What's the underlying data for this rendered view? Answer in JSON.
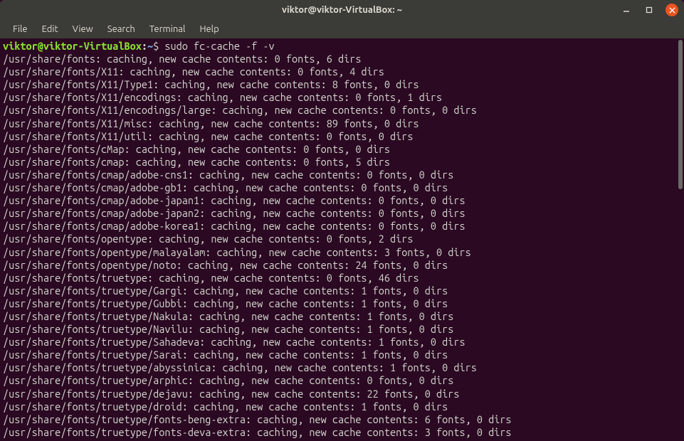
{
  "titlebar": {
    "title": "viktor@viktor-VirtualBox: ~"
  },
  "menubar": {
    "items": [
      {
        "label": "File"
      },
      {
        "label": "Edit"
      },
      {
        "label": "View"
      },
      {
        "label": "Search"
      },
      {
        "label": "Terminal"
      },
      {
        "label": "Help"
      }
    ]
  },
  "prompt": {
    "user": "viktor@viktor-VirtualBox",
    "sep": ":",
    "path": "~",
    "dollar": "$"
  },
  "command": "sudo fc-cache -f -v",
  "output": [
    "/usr/share/fonts: caching, new cache contents: 0 fonts, 6 dirs",
    "/usr/share/fonts/X11: caching, new cache contents: 0 fonts, 4 dirs",
    "/usr/share/fonts/X11/Type1: caching, new cache contents: 8 fonts, 0 dirs",
    "/usr/share/fonts/X11/encodings: caching, new cache contents: 0 fonts, 1 dirs",
    "/usr/share/fonts/X11/encodings/large: caching, new cache contents: 0 fonts, 0 dirs",
    "/usr/share/fonts/X11/misc: caching, new cache contents: 89 fonts, 0 dirs",
    "/usr/share/fonts/X11/util: caching, new cache contents: 0 fonts, 0 dirs",
    "/usr/share/fonts/cMap: caching, new cache contents: 0 fonts, 0 dirs",
    "/usr/share/fonts/cmap: caching, new cache contents: 0 fonts, 5 dirs",
    "/usr/share/fonts/cmap/adobe-cns1: caching, new cache contents: 0 fonts, 0 dirs",
    "/usr/share/fonts/cmap/adobe-gb1: caching, new cache contents: 0 fonts, 0 dirs",
    "/usr/share/fonts/cmap/adobe-japan1: caching, new cache contents: 0 fonts, 0 dirs",
    "/usr/share/fonts/cmap/adobe-japan2: caching, new cache contents: 0 fonts, 0 dirs",
    "/usr/share/fonts/cmap/adobe-korea1: caching, new cache contents: 0 fonts, 0 dirs",
    "/usr/share/fonts/opentype: caching, new cache contents: 0 fonts, 2 dirs",
    "/usr/share/fonts/opentype/malayalam: caching, new cache contents: 3 fonts, 0 dirs",
    "/usr/share/fonts/opentype/noto: caching, new cache contents: 24 fonts, 0 dirs",
    "/usr/share/fonts/truetype: caching, new cache contents: 0 fonts, 46 dirs",
    "/usr/share/fonts/truetype/Gargi: caching, new cache contents: 1 fonts, 0 dirs",
    "/usr/share/fonts/truetype/Gubbi: caching, new cache contents: 1 fonts, 0 dirs",
    "/usr/share/fonts/truetype/Nakula: caching, new cache contents: 1 fonts, 0 dirs",
    "/usr/share/fonts/truetype/Navilu: caching, new cache contents: 1 fonts, 0 dirs",
    "/usr/share/fonts/truetype/Sahadeva: caching, new cache contents: 1 fonts, 0 dirs",
    "/usr/share/fonts/truetype/Sarai: caching, new cache contents: 1 fonts, 0 dirs",
    "/usr/share/fonts/truetype/abyssinica: caching, new cache contents: 1 fonts, 0 dirs",
    "/usr/share/fonts/truetype/arphic: caching, new cache contents: 0 fonts, 0 dirs",
    "/usr/share/fonts/truetype/dejavu: caching, new cache contents: 22 fonts, 0 dirs",
    "/usr/share/fonts/truetype/droid: caching, new cache contents: 1 fonts, 0 dirs",
    "/usr/share/fonts/truetype/fonts-beng-extra: caching, new cache contents: 6 fonts, 0 dirs",
    "/usr/share/fonts/truetype/fonts-deva-extra: caching, new cache contents: 3 fonts, 0 dirs"
  ]
}
